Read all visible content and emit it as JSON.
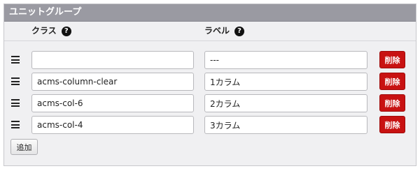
{
  "panel": {
    "title": "ユニットグループ"
  },
  "columns": {
    "class_label": "クラス",
    "label_label": "ラベル",
    "help_glyph": "?"
  },
  "rows": [
    {
      "class_value": "",
      "label_value": "---",
      "delete_label": "削除"
    },
    {
      "class_value": "acms-column-clear",
      "label_value": "1カラム",
      "delete_label": "削除"
    },
    {
      "class_value": "acms-col-6",
      "label_value": "2カラム",
      "delete_label": "削除"
    },
    {
      "class_value": "acms-col-4",
      "label_value": "3カラム",
      "delete_label": "削除"
    }
  ],
  "actions": {
    "add_label": "追加"
  },
  "colors": {
    "header_bg": "#9a9aa2",
    "panel_bg": "#f0f0f2",
    "delete_bg": "#c81212"
  }
}
